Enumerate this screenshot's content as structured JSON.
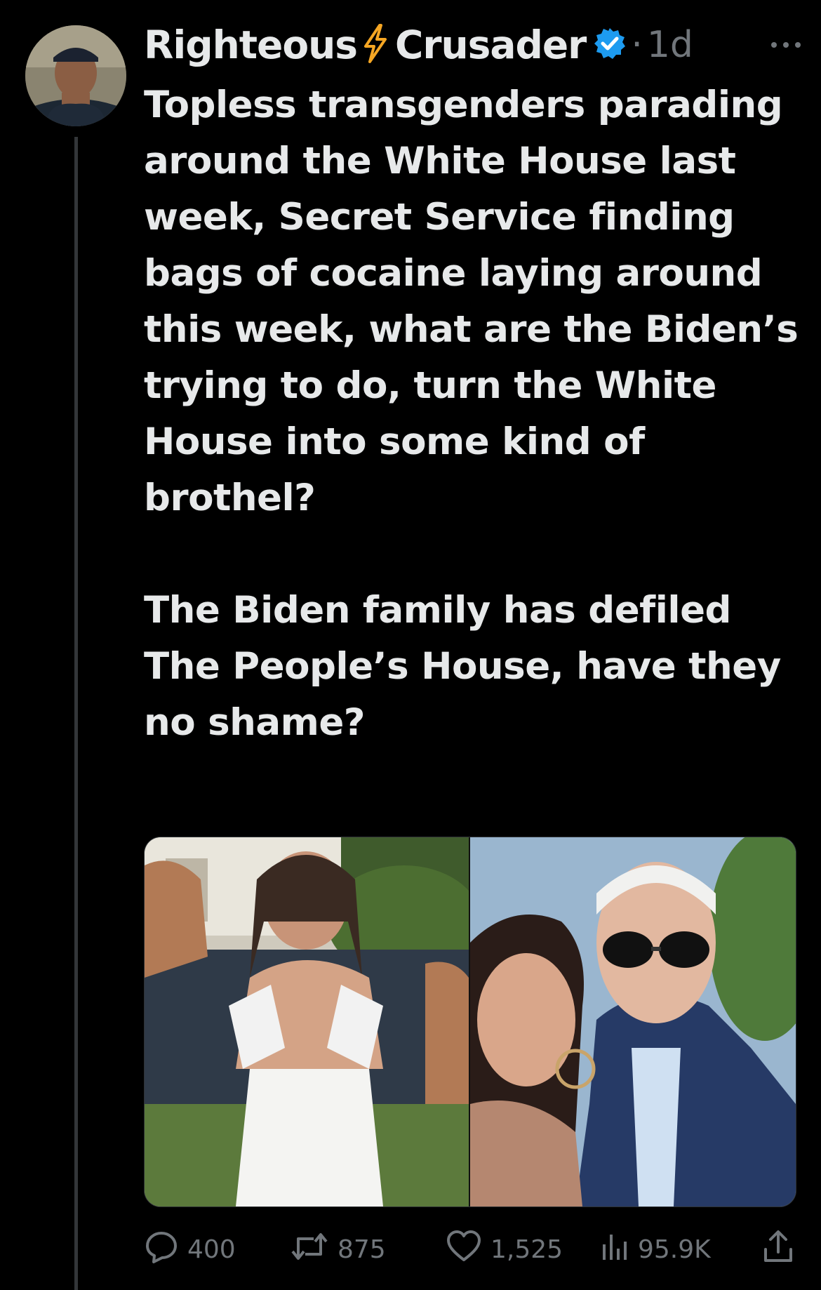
{
  "post": {
    "author": {
      "name_first": "Righteous",
      "name_last": "Crusader",
      "verified": true
    },
    "separator": "·",
    "time": "1d",
    "text_paragraphs": [
      "Topless transgenders parading around the White House last week, Secret Service finding bags of cocaine laying around this week, what are the Biden’s trying to do, turn the White House into some kind of brothel?",
      "The Biden family has defiled The People’s House, have they no shame?"
    ]
  },
  "media": {
    "count": 2
  },
  "metrics": {
    "replies": "400",
    "reposts": "875",
    "likes": "1,525",
    "views": "95.9K"
  },
  "colors": {
    "background": "#000000",
    "text_primary": "#e7e9ea",
    "text_secondary": "#71767b",
    "verified_blue": "#1d9bf0",
    "bolt_orange": "#f5a623",
    "thread_line": "#333639"
  },
  "icons": {
    "bolt": "lightning-bolt-icon",
    "verified": "verified-badge-icon",
    "more": "more-options-icon",
    "reply": "reply-icon",
    "repost": "repost-icon",
    "like": "heart-icon",
    "views": "views-icon",
    "share": "share-icon"
  }
}
